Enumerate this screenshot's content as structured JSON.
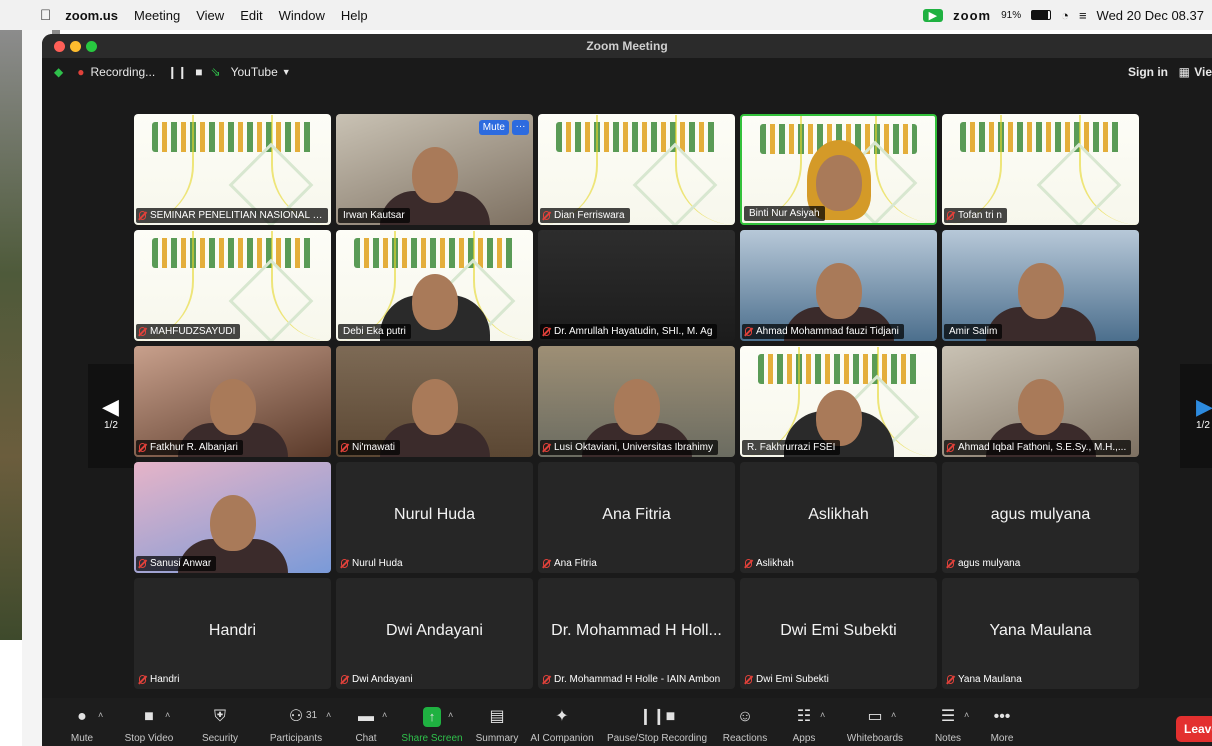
{
  "menubar": {
    "app": "zoom.us",
    "items": [
      "Meeting",
      "View",
      "Edit",
      "Window",
      "Help"
    ],
    "zoom_logo": "zoom",
    "battery": "91%",
    "clock": "Wed 20 Dec  08.37"
  },
  "window": {
    "title": "Zoom Meeting"
  },
  "secbar": {
    "recording": "Recording...",
    "youtube": "YouTube",
    "signin": "Sign in",
    "view": "Vie"
  },
  "pager": {
    "left": "1/2",
    "right": "1/2"
  },
  "tiles": [
    {
      "label": "SEMINAR PENELITIAN NASIONAL &...",
      "kind": "slide",
      "muted": true
    },
    {
      "label": "Irwan Kautsar",
      "kind": "video-a",
      "muted": false,
      "mute_btn": "Mute",
      "more_btn": "···"
    },
    {
      "label": "Dian Ferriswara",
      "kind": "slide",
      "muted": true
    },
    {
      "label": "Binti Nur Asiyah",
      "kind": "slide-speaker",
      "muted": false
    },
    {
      "label": "Tofan tri n",
      "kind": "slide",
      "muted": true
    },
    {
      "label": "MAHFUDZSAYUDI",
      "kind": "slide",
      "muted": true
    },
    {
      "label": "Debi Eka putri",
      "kind": "slide-person",
      "muted": false
    },
    {
      "label": "Dr. Amrullah Hayatudin, SHI., M. Ag",
      "kind": "video-c",
      "muted": true
    },
    {
      "label": "Ahmad Mohammad fauzi Tidjani",
      "kind": "video-b",
      "muted": true
    },
    {
      "label": "Amir Salim",
      "kind": "video-b",
      "muted": false
    },
    {
      "label": "Fatkhur R. Albanjari",
      "kind": "video-d",
      "muted": true
    },
    {
      "label": "Ni'mawati",
      "kind": "video-e",
      "muted": true
    },
    {
      "label": "Lusi Oktaviani, Universitas Ibrahimy",
      "kind": "video-f",
      "muted": true
    },
    {
      "label": "R. Fakhrurrazi FSEI",
      "kind": "slide-person",
      "muted": false
    },
    {
      "label": "Ahmad Iqbal Fathoni, S.E.Sy., M.H.,...",
      "kind": "video-a",
      "muted": true
    },
    {
      "label": "Sanusi Anwar",
      "kind": "video-g",
      "muted": true
    },
    {
      "label": "Nurul Huda",
      "kind": "name",
      "muted": true,
      "big": "Nurul Huda"
    },
    {
      "label": "Ana Fitria",
      "kind": "name",
      "muted": true,
      "big": "Ana Fitria"
    },
    {
      "label": "Aslikhah",
      "kind": "name",
      "muted": true,
      "big": "Aslikhah"
    },
    {
      "label": "agus mulyana",
      "kind": "name",
      "muted": true,
      "big": "agus mulyana"
    },
    {
      "label": "Handri",
      "kind": "name",
      "muted": true,
      "big": "Handri"
    },
    {
      "label": "Dwi Andayani",
      "kind": "name",
      "muted": true,
      "big": "Dwi Andayani"
    },
    {
      "label": "Dr. Mohammad H Holle - IAIN Ambon",
      "kind": "name",
      "muted": true,
      "big": "Dr. Mohammad H Holl..."
    },
    {
      "label": "Dwi Emi Subekti",
      "kind": "name",
      "muted": true,
      "big": "Dwi Emi Subekti"
    },
    {
      "label": "Yana Maulana",
      "kind": "name",
      "muted": true,
      "big": "Yana Maulana"
    }
  ],
  "toolbar": [
    {
      "label": "Mute",
      "icon": "mic-icon",
      "caret": true
    },
    {
      "label": "Stop Video",
      "icon": "video-icon",
      "caret": true
    },
    {
      "label": "Security",
      "icon": "shield-icon",
      "caret": false
    },
    {
      "label": "Participants",
      "icon": "participants-icon",
      "caret": true,
      "count": "31"
    },
    {
      "label": "Chat",
      "icon": "chat-icon",
      "caret": true
    },
    {
      "label": "Share Screen",
      "icon": "share-icon",
      "caret": true,
      "highlight": true
    },
    {
      "label": "Summary",
      "icon": "summary-icon",
      "caret": false
    },
    {
      "label": "AI Companion",
      "icon": "sparkle-icon",
      "caret": false
    },
    {
      "label": "Pause/Stop Recording",
      "icon": "pause-stop-icon",
      "caret": false
    },
    {
      "label": "Reactions",
      "icon": "reactions-icon",
      "caret": false
    },
    {
      "label": "Apps",
      "icon": "apps-icon",
      "caret": true
    },
    {
      "label": "Whiteboards",
      "icon": "whiteboard-icon",
      "caret": true
    },
    {
      "label": "Notes",
      "icon": "notes-icon",
      "caret": true
    },
    {
      "label": "More",
      "icon": "more-icon",
      "caret": false
    }
  ],
  "leave": "Leave",
  "colors": {
    "toolbar_bg": "#1d1d1d",
    "window_bg": "#1a1a1a",
    "active_speaker": "#33c13b",
    "share_green": "#1fb141",
    "leave_red": "#e3302f",
    "mute_blue": "#2d6bdf"
  }
}
